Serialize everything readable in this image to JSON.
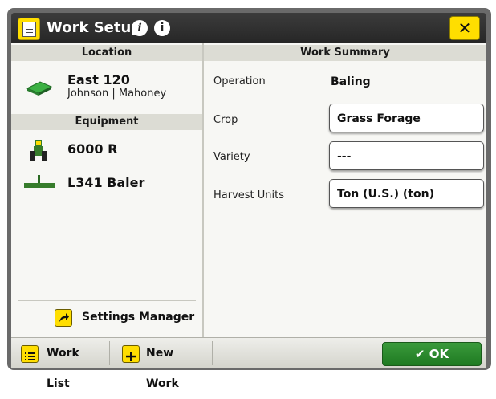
{
  "window": {
    "title": "Work Setup",
    "close_icon": "close-icon",
    "info_icons": [
      "help-icon",
      "info-icon"
    ]
  },
  "left": {
    "location_header": "Location",
    "location": {
      "name": "East 120",
      "owner": "Johnson | Mahoney",
      "icon": "field-icon"
    },
    "equipment_header": "Equipment",
    "equipment": [
      {
        "name": "6000 R",
        "icon": "tractor-icon"
      },
      {
        "name": "L341 Baler",
        "icon": "baler-icon"
      }
    ],
    "settings_manager": "Settings Manager"
  },
  "summary": {
    "header": "Work Summary",
    "operation_label": "Operation",
    "operation_value": "Baling",
    "crop_label": "Crop",
    "crop_value": "Grass Forage",
    "variety_label": "Variety",
    "variety_value": "---",
    "units_label": "Harvest Units",
    "units_value": "Ton (U.S.) (ton)"
  },
  "footer": {
    "work_list": "Work List",
    "new_work": "New Work",
    "ok": "OK"
  },
  "colors": {
    "accent_yellow": "#ffde00",
    "ok_green": "#2b8a2e",
    "titlebar": "#2f2f2f",
    "jd_green": "#367c2b"
  }
}
